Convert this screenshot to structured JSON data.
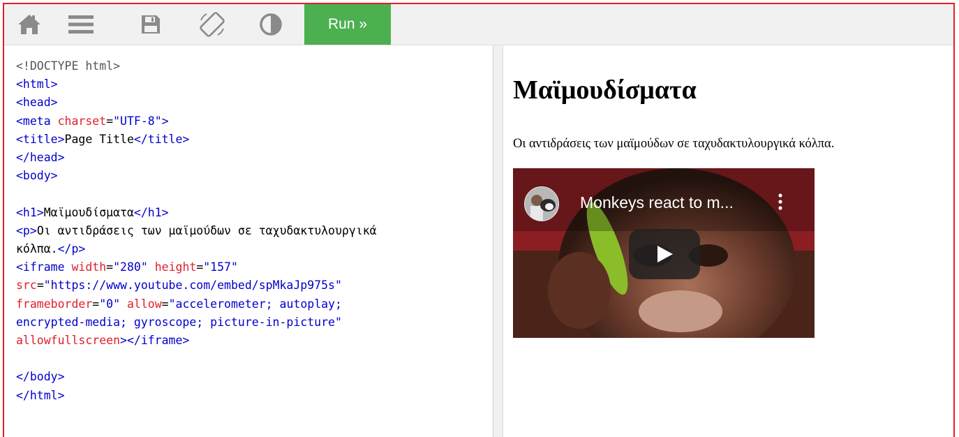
{
  "toolbar": {
    "icons": [
      "home-icon",
      "menu-icon",
      "save-icon",
      "rotate-icon",
      "contrast-icon"
    ],
    "run_label": "Run »",
    "run_color": "#4caf50",
    "border_color": "#e41f26"
  },
  "editor": {
    "lines": [
      [
        [
          "doc",
          "<!DOCTYPE html>"
        ]
      ],
      [
        [
          "tag",
          "<html>"
        ]
      ],
      [
        [
          "tag",
          "<head>"
        ]
      ],
      [
        [
          "tag",
          "<meta "
        ],
        [
          "attr",
          "charset"
        ],
        [
          "txt",
          "="
        ],
        [
          "val",
          "\"UTF-8\""
        ],
        [
          "tag",
          ">"
        ]
      ],
      [
        [
          "tag",
          "<title>"
        ],
        [
          "txt",
          "Page Title"
        ],
        [
          "tag",
          "</title>"
        ]
      ],
      [
        [
          "tag",
          "</head>"
        ]
      ],
      [
        [
          "tag",
          "<body>"
        ]
      ],
      [],
      [
        [
          "tag",
          "<h1>"
        ],
        [
          "txt",
          "Μαϊμουδίσματα"
        ],
        [
          "tag",
          "</h1>"
        ]
      ],
      [
        [
          "tag",
          "<p>"
        ],
        [
          "txt",
          "Οι αντιδράσεις των μαϊμούδων σε ταχυδακτυλουργικά"
        ]
      ],
      [
        [
          "txt",
          "κόλπα."
        ],
        [
          "tag",
          "</p>"
        ]
      ],
      [
        [
          "tag",
          "<iframe "
        ],
        [
          "attr",
          "width"
        ],
        [
          "txt",
          "="
        ],
        [
          "val",
          "\"280\""
        ],
        [
          "txt",
          " "
        ],
        [
          "attr",
          "height"
        ],
        [
          "txt",
          "="
        ],
        [
          "val",
          "\"157\""
        ]
      ],
      [
        [
          "attr",
          "src"
        ],
        [
          "txt",
          "="
        ],
        [
          "val",
          "\"https://www.youtube.com/embed/spMkaJp975s\""
        ]
      ],
      [
        [
          "attr",
          "frameborder"
        ],
        [
          "txt",
          "="
        ],
        [
          "val",
          "\"0\""
        ],
        [
          "txt",
          " "
        ],
        [
          "attr",
          "allow"
        ],
        [
          "txt",
          "="
        ],
        [
          "val",
          "\"accelerometer; autoplay;"
        ]
      ],
      [
        [
          "val",
          "encrypted-media; gyroscope; picture-in-picture\""
        ]
      ],
      [
        [
          "attr",
          "allowfullscreen"
        ],
        [
          "tag",
          "></iframe>"
        ]
      ],
      [],
      [
        [
          "tag",
          "</body>"
        ]
      ],
      [
        [
          "tag",
          "</html>"
        ]
      ]
    ]
  },
  "result": {
    "heading": "Μαϊμουδίσματα",
    "paragraph": "Οι αντιδράσεις των μαϊμούδων σε ταχυδακτυλουργικά κόλπα.",
    "video": {
      "title": "Monkeys react to m...",
      "icons": [
        "play-icon",
        "more-options-icon",
        "channel-avatar-icon"
      ]
    }
  }
}
